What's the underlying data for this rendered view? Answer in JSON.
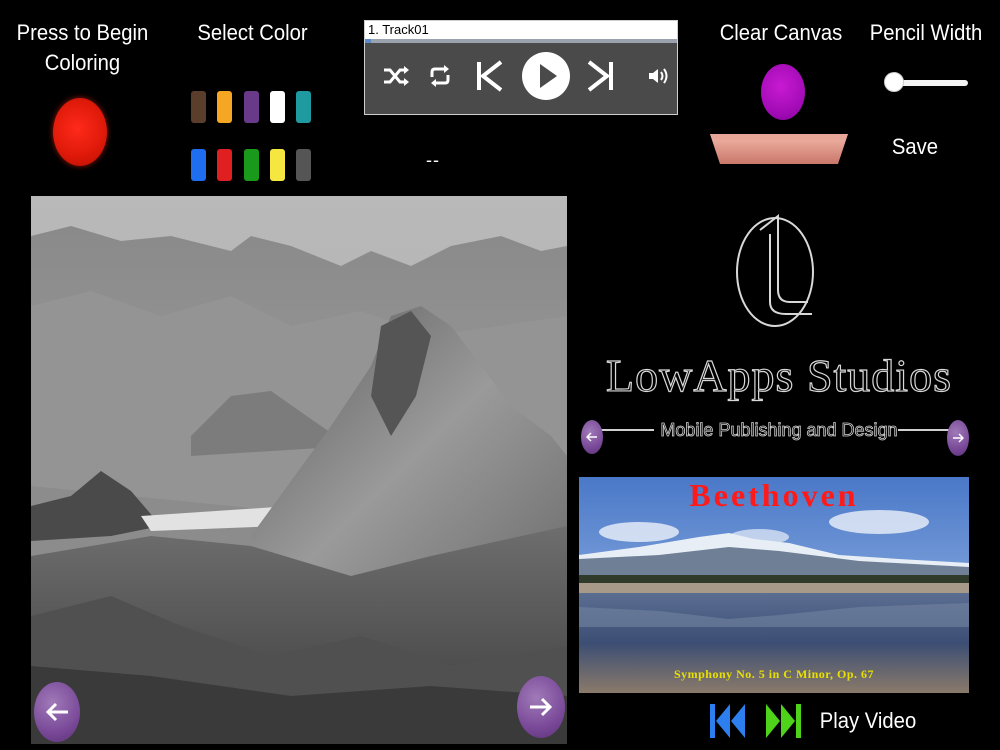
{
  "coloring": {
    "begin_label": "Press to Begin Coloring",
    "begin_color": "#e01a0a"
  },
  "palette": {
    "label": "Select Color",
    "colors": [
      "#5a3d2a",
      "#f5a623",
      "#6a3a8a",
      "#ffffff",
      "#1e9aa0",
      "#1f6ef0",
      "#e02020",
      "#1a9a1a",
      "#f5e640",
      "#555555"
    ]
  },
  "player": {
    "track": "1.  Track01",
    "progress": 0.02,
    "buttons": [
      "shuffle-icon",
      "repeat-icon",
      "previous-icon",
      "play-icon",
      "next-icon",
      "volume-icon"
    ]
  },
  "status_text": "--",
  "canvas": {
    "clear_label": "Clear Canvas",
    "clear_color": "#9e0ab2",
    "pencil_label": "Pencil Width",
    "pencil_width": 0,
    "save_label": "Save"
  },
  "studio": {
    "name": "LowApps Studios",
    "tagline": "Mobile Publishing and Design"
  },
  "album": {
    "title": "Beethoven",
    "subtitle": "Symphony No. 5 in C Minor, Op. 67"
  },
  "video": {
    "label": "Play Video"
  }
}
